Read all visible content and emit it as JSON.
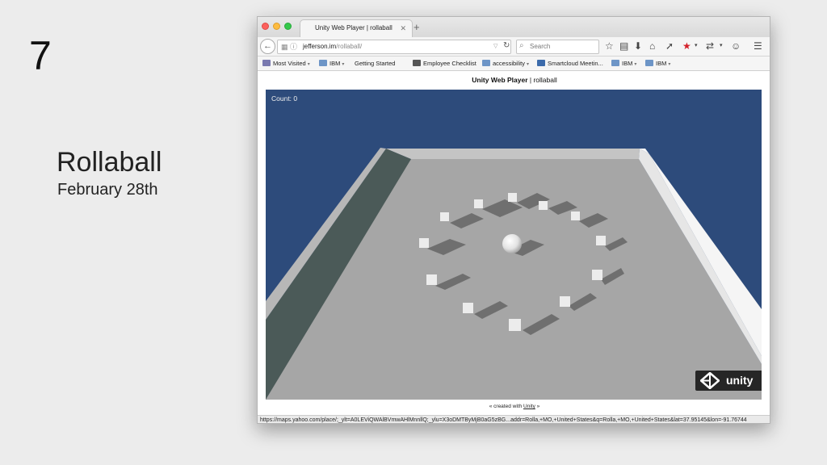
{
  "slide": {
    "number": "7",
    "title": "Rollaball",
    "date": "February 28th"
  },
  "browser": {
    "tab_title": "Unity Web Player | rollaball",
    "tab_close": "✕",
    "new_tab": "+",
    "url_host": "jefferson.im",
    "url_path": "/rollaball/",
    "search_placeholder": "Search",
    "bookmarks": [
      {
        "label": "Most Visited",
        "icon": "most-visited-icon",
        "caret": "▾"
      },
      {
        "label": "IBM",
        "icon": "folder-icon",
        "caret": "▾"
      },
      {
        "label": "Getting Started",
        "icon": "page-icon",
        "caret": ""
      },
      {
        "label": "Employee Checklist",
        "icon": "wc-icon",
        "caret": ""
      },
      {
        "label": "accessibility",
        "icon": "folder-icon",
        "caret": "▾"
      },
      {
        "label": "Smartcloud Meetin...",
        "icon": "ibm-icon",
        "caret": ""
      },
      {
        "label": "IBM",
        "icon": "folder-icon",
        "caret": "▾"
      },
      {
        "label": "IBM",
        "icon": "folder-icon",
        "caret": "▾"
      }
    ],
    "status_url": "https://maps.yahoo.com/place/;_ylt=A0LEViQWAlBVmwAHlMnnllQ;_ylu=X3oDMTByMjB0aG5zBG...addr=Rolla,+MO,+United+States&q=Rolla,+MO,+United+States&lat=37.95145&lon=-91.76744"
  },
  "page": {
    "heading_bold": "Unity Web Player",
    "heading_rest": " | rollaball",
    "count_label": "Count: 0",
    "unity_badge": "unity",
    "credit_prefix": "« created with ",
    "credit_link": "Unity",
    "credit_suffix": " »"
  },
  "colors": {
    "sky": "#2d4b7b",
    "floor": "#a6a6a6",
    "accent_red": "#d4202a"
  }
}
